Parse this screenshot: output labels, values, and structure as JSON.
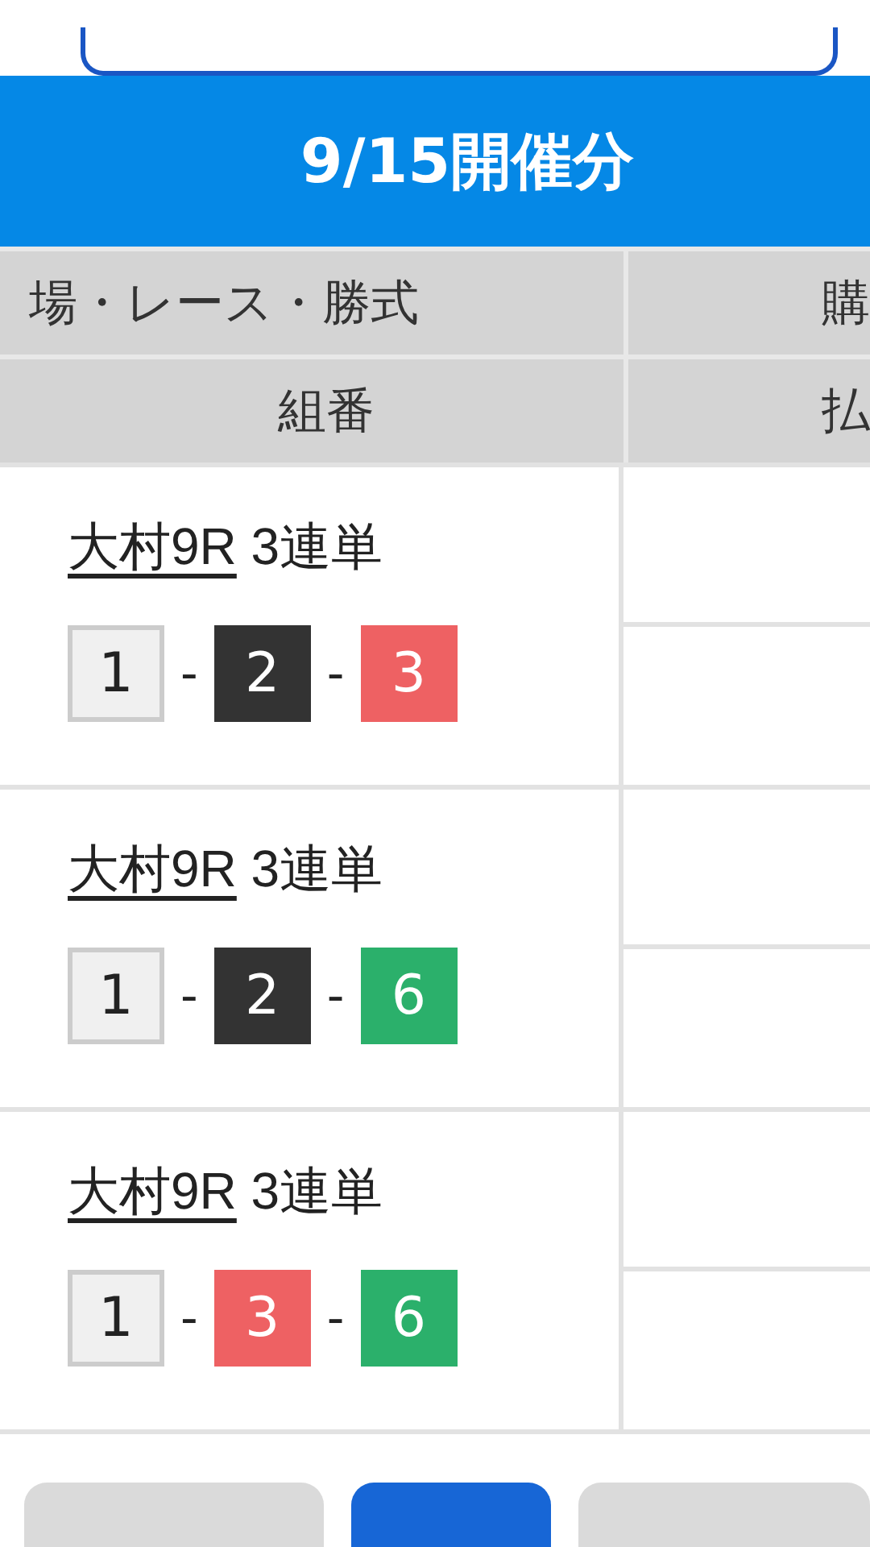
{
  "banner": {
    "title": "9/15開催分"
  },
  "table": {
    "header_rows": [
      [
        "場・レース・勝式",
        "購"
      ],
      [
        "組番",
        "払"
      ]
    ],
    "rows": [
      {
        "race_link": "大村9R",
        "bet_type": "3連単",
        "combination": [
          {
            "number": "1",
            "color": "#f0f0f0"
          },
          {
            "number": "2",
            "color": "#333333"
          },
          {
            "number": "3",
            "color": "#ee6163"
          }
        ],
        "separator": "-"
      },
      {
        "race_link": "大村9R",
        "bet_type": "3連単",
        "combination": [
          {
            "number": "1",
            "color": "#f0f0f0"
          },
          {
            "number": "2",
            "color": "#333333"
          },
          {
            "number": "6",
            "color": "#2bb06b"
          }
        ],
        "separator": "-"
      },
      {
        "race_link": "大村9R",
        "bet_type": "3連単",
        "combination": [
          {
            "number": "1",
            "color": "#f0f0f0"
          },
          {
            "number": "3",
            "color": "#ee6163"
          },
          {
            "number": "6",
            "color": "#2bb06b"
          }
        ],
        "separator": "-"
      }
    ]
  },
  "footer_buttons": [
    {
      "kind": "secondary"
    },
    {
      "kind": "primary"
    },
    {
      "kind": "secondary"
    }
  ]
}
